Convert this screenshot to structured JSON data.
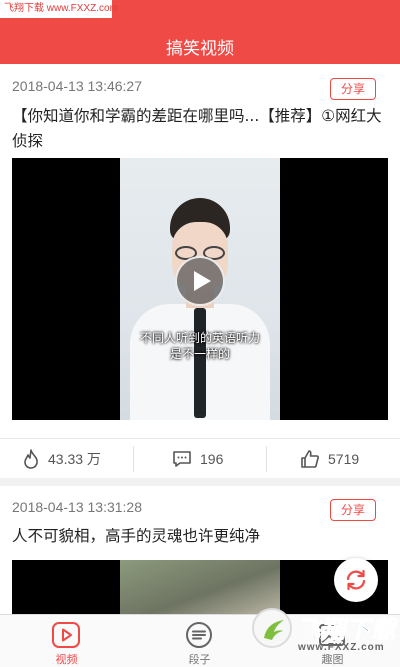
{
  "watermark": {
    "text": "飞翔下载 www.FXXZ.com"
  },
  "header": {
    "title": "搞笑视频"
  },
  "posts": [
    {
      "time": "2018-04-13 13:46:27",
      "share_label": "分享",
      "title": "【你知道你和学霸的差距在哪里吗...【推荐】①网红大侦探",
      "subtitle_line1": "不同人听到的英语听力",
      "subtitle_line2": "是不一样的",
      "likes": "43.33 万",
      "comments": "196",
      "thumbs": "5719"
    },
    {
      "time": "2018-04-13 13:31:28",
      "share_label": "分享",
      "title": "人不可貌相，高手的灵魂也许更纯净"
    }
  ],
  "tabs": [
    {
      "label": "视频",
      "icon": "play-icon",
      "active": true
    },
    {
      "label": "段子",
      "icon": "message-icon",
      "active": false
    },
    {
      "label": "趣图",
      "icon": "image-icon",
      "active": false
    }
  ],
  "badge": {
    "name": "飞翔下载",
    "url": "www.FXXZ.com"
  },
  "colors": {
    "accent": "#f04a46",
    "tab_active": "#f04a46",
    "badge_blue": "#2a6fb8"
  }
}
